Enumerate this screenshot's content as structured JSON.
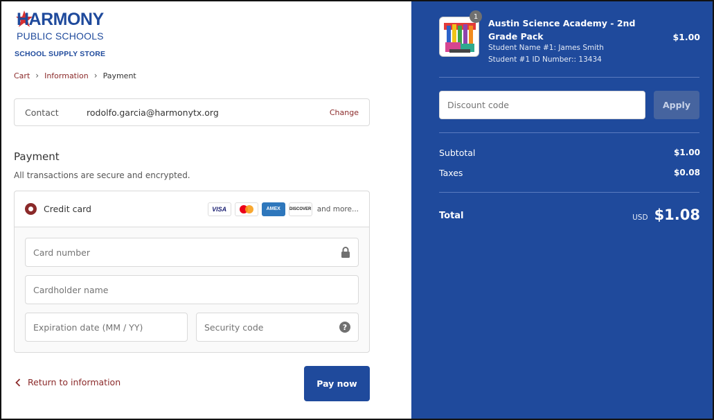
{
  "brand": {
    "line1": "HARMONY",
    "line2": "PUBLIC SCHOOLS",
    "line3": "SCHOOL SUPPLY STORE",
    "color": "#1f4a9c",
    "star_color": "#d92f2f"
  },
  "breadcrumb": {
    "items": [
      "Cart",
      "Information",
      "Payment"
    ],
    "separator": ">"
  },
  "contact": {
    "label": "Contact",
    "email": "rodolfo.garcia@harmonytx.org",
    "change_label": "Change"
  },
  "payment": {
    "title": "Payment",
    "subtitle": "All transactions are secure and encrypted.",
    "method_label": "Credit card",
    "card_brands": [
      "VISA",
      "mastercard-icon",
      "AMEX",
      "DISCOVER"
    ],
    "more_label": "and more...",
    "fields": {
      "card_number": "Card number",
      "cardholder_name": "Cardholder name",
      "expiration": "Expiration date (MM / YY)",
      "security_code": "Security code"
    }
  },
  "actions": {
    "return_label": "Return to information",
    "pay_label": "Pay now"
  },
  "order": {
    "quantity": "1",
    "product_title": "Austin Science Academy - 2nd Grade Pack",
    "meta": [
      "Student Name #1: James Smith",
      "Student #1 ID Number:: 13434"
    ],
    "price": "$1.00",
    "discount_placeholder": "Discount code",
    "apply_label": "Apply",
    "subtotal_label": "Subtotal",
    "subtotal_value": "$1.00",
    "taxes_label": "Taxes",
    "taxes_value": "$0.08",
    "total_label": "Total",
    "currency": "USD",
    "total_value": "$1.08"
  },
  "colors": {
    "accent": "#8b2a2a",
    "primary": "#1f4a9c",
    "border": "#d9d9d9"
  }
}
